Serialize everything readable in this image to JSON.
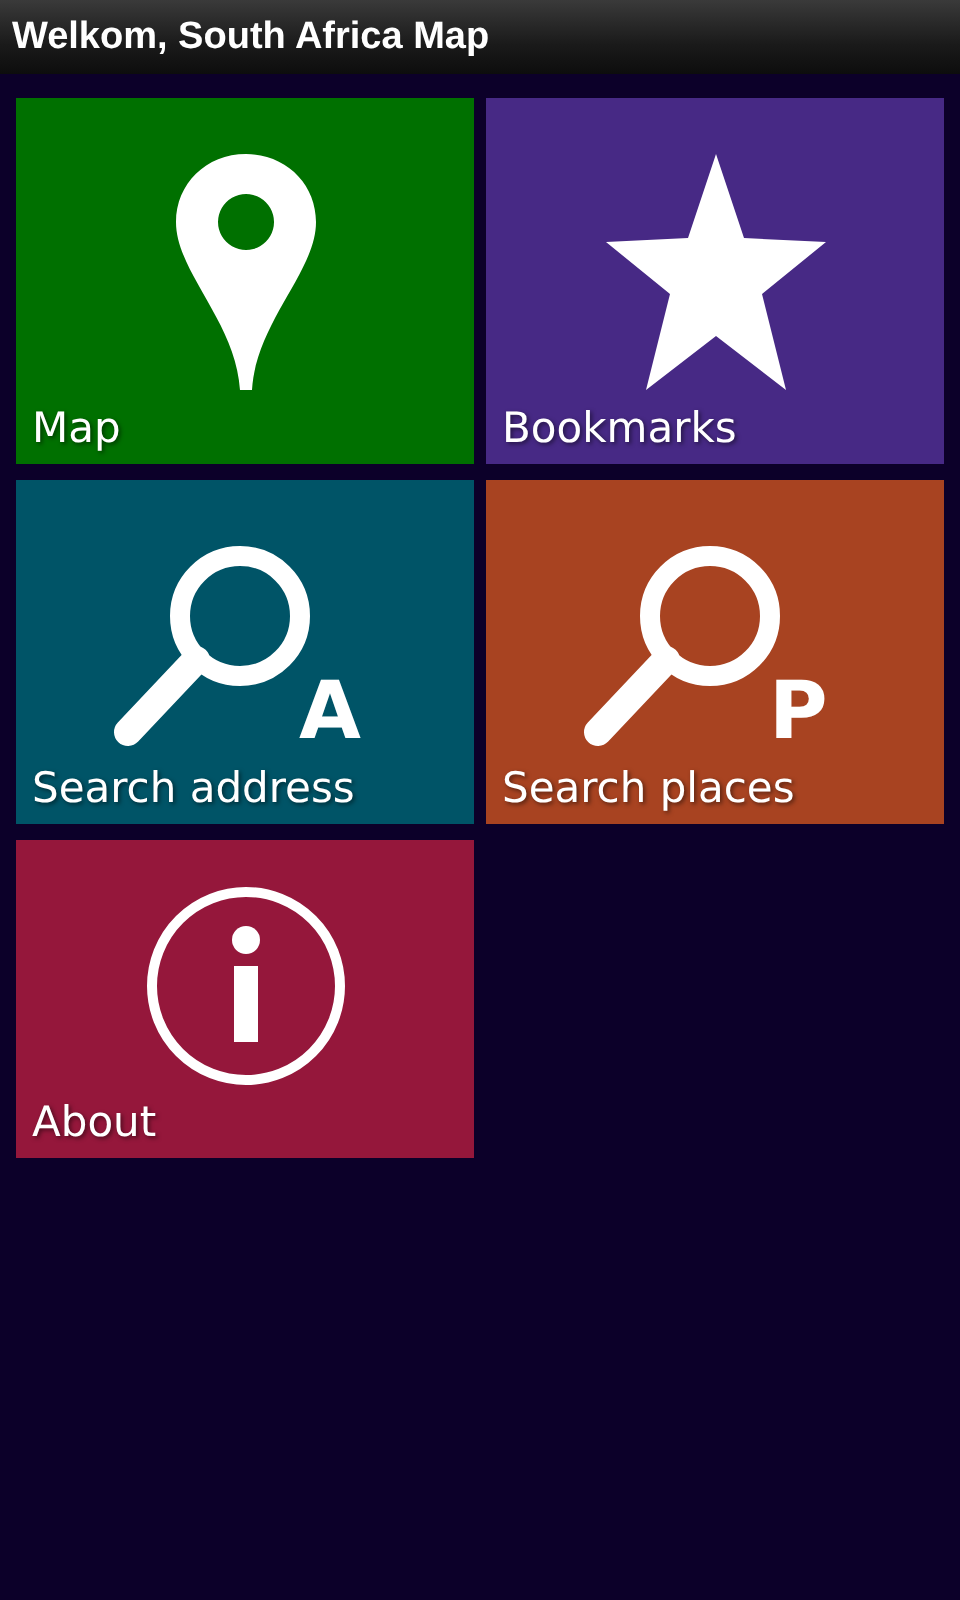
{
  "title_bar": {
    "title": "Welkom, South Africa Map"
  },
  "tiles": [
    {
      "label": "Map",
      "color": "#007000",
      "kind": "pin"
    },
    {
      "label": "Bookmarks",
      "color": "#472985",
      "kind": "star"
    },
    {
      "label": "Search address",
      "color": "#005467",
      "kind": "search",
      "letter": "A"
    },
    {
      "label": "Search places",
      "color": "#a84321",
      "kind": "search",
      "letter": "P"
    },
    {
      "label": "About",
      "color": "#95173b",
      "kind": "info"
    }
  ]
}
